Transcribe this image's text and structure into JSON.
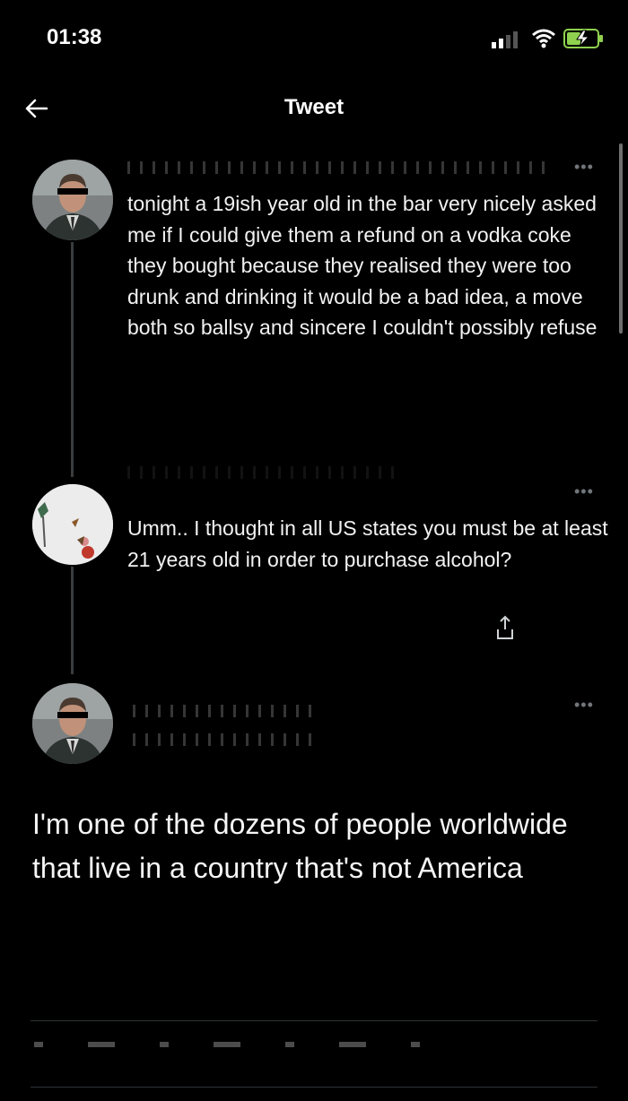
{
  "status_bar": {
    "time": "01:38"
  },
  "header": {
    "title": "Tweet"
  },
  "tweets": [
    {
      "text": "tonight a 19ish year old in the bar very nicely asked me if I could give them a refund on a vodka coke they bought because they realised they were too drunk and drinking it would be a bad idea, a move both so ballsy and sincere I couldn't possibly refuse"
    },
    {
      "text": "Umm.. I thought in all US states you must be at least 21 years old in order to purchase alcohol?"
    }
  ],
  "main_tweet": {
    "text": "I'm one of the dozens of people worldwide that live in a country that's not America"
  },
  "icons": {
    "back": "back-arrow-icon",
    "more": "more-icon",
    "share": "share-icon",
    "signal": "cellular-signal-icon",
    "wifi": "wifi-icon",
    "battery": "battery-charging-icon"
  }
}
